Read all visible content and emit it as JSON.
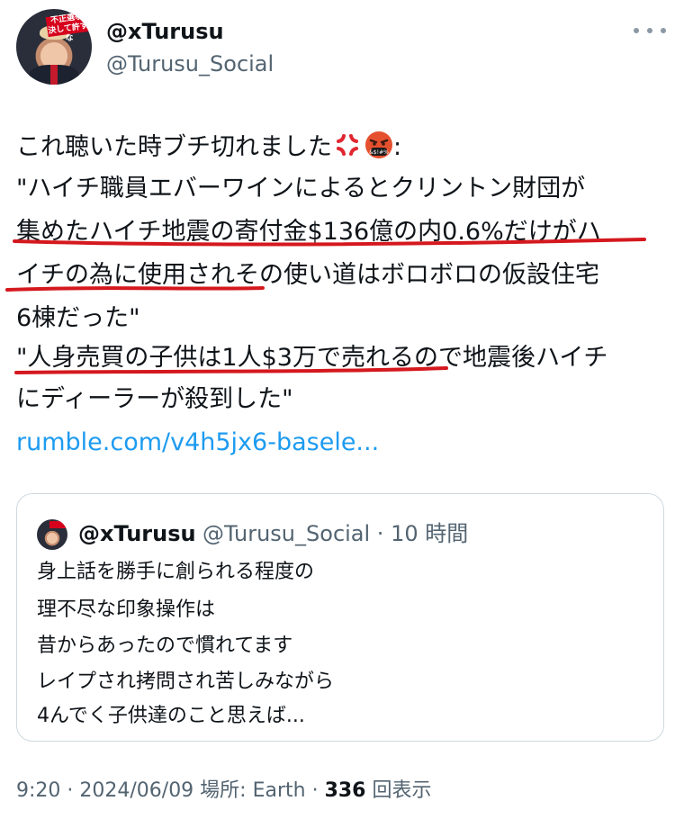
{
  "author": {
    "display_name": "@xTurusu",
    "handle": "@Turusu_Social",
    "avatar_badge_text": "不正選挙 決して許すな"
  },
  "tweet": {
    "lines": [
      "これ聴いた時ブチ切れました",
      "\"ハイチ職員エバーワインによるとクリントン財団が",
      "集めたハイチ地震の寄付金$136億の内0.6%だけがハ",
      "イチの為に使用されその使い道はボロボロの仮設住宅",
      "6棟だった\"",
      "\"人身売買の子供は1人$3万で売れるので地震後ハイチ",
      "にディーラーが殺到した\""
    ],
    "line1_suffix": ":",
    "emojis": [
      "anger-symbol-icon",
      "face-with-symbols-icon"
    ],
    "link": "rumble.com/v4h5jx6-basele..."
  },
  "quote": {
    "display_name": "@xTurusu",
    "handle_time": "@Turusu_Social · 10 時間",
    "lines": [
      "身上話を勝手に創られる程度の",
      "理不尽な印象操作は",
      "昔からあったので慣れてます",
      "レイプされ拷問され苦しみながら",
      "4んでく子供達のこと思えば..."
    ]
  },
  "footer": {
    "meta": "9:20 · 2024/06/09 場所: Earth · ",
    "views_count": "336",
    "views_label": " 回表示"
  },
  "colors": {
    "text": "#0f1419",
    "secondary": "#536471",
    "link": "#1d9bf0",
    "underline": "#d4181e",
    "border": "#cfd9de"
  }
}
